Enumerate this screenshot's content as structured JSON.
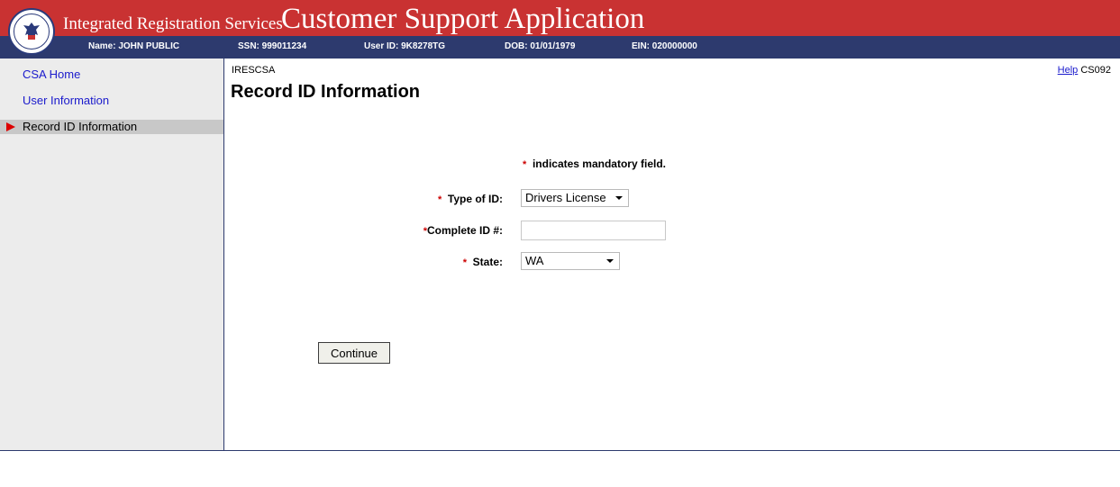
{
  "header": {
    "subtitle": "Integrated Registration Services",
    "title": "Customer Support Application",
    "logo_text": "SOCIAL SECURITY ADMINISTRATION USA",
    "colors": {
      "banner": "#c93232",
      "infobar": "#2d3a6e"
    }
  },
  "infobar": {
    "name": "Name: JOHN PUBLIC",
    "ssn": "SSN: 999011234",
    "user_id": "User ID: 9K8278TG",
    "dob": "DOB: 01/01/1979",
    "ein": "EIN: 020000000"
  },
  "sidebar": {
    "items": [
      {
        "label": "CSA Home",
        "active": false
      },
      {
        "label": "User Information",
        "active": false
      },
      {
        "label": "Record ID Information",
        "active": true,
        "icon": "red-arrow-icon"
      }
    ]
  },
  "main": {
    "breadcrumb": "IRESCSA",
    "help_label": "Help",
    "screen_code": "CS092",
    "page_title": "Record ID Information",
    "mandatory_marker": "*",
    "mandatory_note": "indicates mandatory field.",
    "form": {
      "type_of_id": {
        "label": "Type of ID:",
        "value": "Drivers License"
      },
      "complete_id": {
        "label": "Complete ID #:",
        "value": ""
      },
      "state": {
        "label": "State:",
        "value": "WA"
      }
    },
    "continue_label": "Continue"
  }
}
